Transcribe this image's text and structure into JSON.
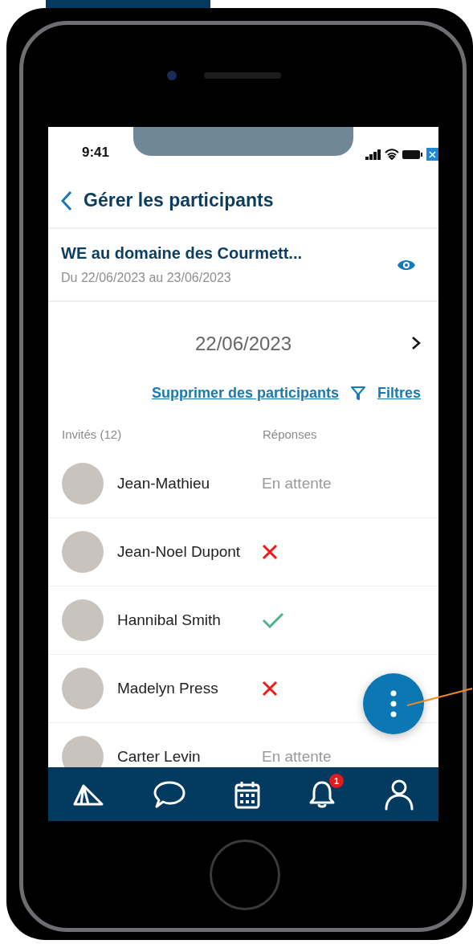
{
  "status_bar": {
    "time": "9:41"
  },
  "header": {
    "title": "Gérer les participants"
  },
  "event": {
    "title": "WE au domaine des Courmett...",
    "dates": "Du 22/06/2023 au 23/06/2023"
  },
  "date_nav": {
    "date": "22/06/2023"
  },
  "actions": {
    "remove_link": "Supprimer des participants",
    "filter_link": "Filtres"
  },
  "columns": [
    "Invités (12)",
    "Réponses"
  ],
  "participants": [
    {
      "name": "Jean-Mathieu",
      "response": {
        "kind": "pending",
        "text": "En attente"
      }
    },
    {
      "name": "Jean-Noel Dupont",
      "response": {
        "kind": "declined"
      }
    },
    {
      "name": "Hannibal Smith",
      "response": {
        "kind": "accepted"
      }
    },
    {
      "name": "Madelyn Press",
      "response": {
        "kind": "declined"
      }
    },
    {
      "name": "Carter Levin",
      "response": {
        "kind": "pending",
        "text": "En attente"
      }
    }
  ],
  "tab_bar": {
    "items": [
      {
        "kind": "tent"
      },
      {
        "kind": "chat"
      },
      {
        "kind": "calendar"
      },
      {
        "kind": "bell",
        "badge": "1"
      },
      {
        "kind": "profile"
      }
    ]
  }
}
